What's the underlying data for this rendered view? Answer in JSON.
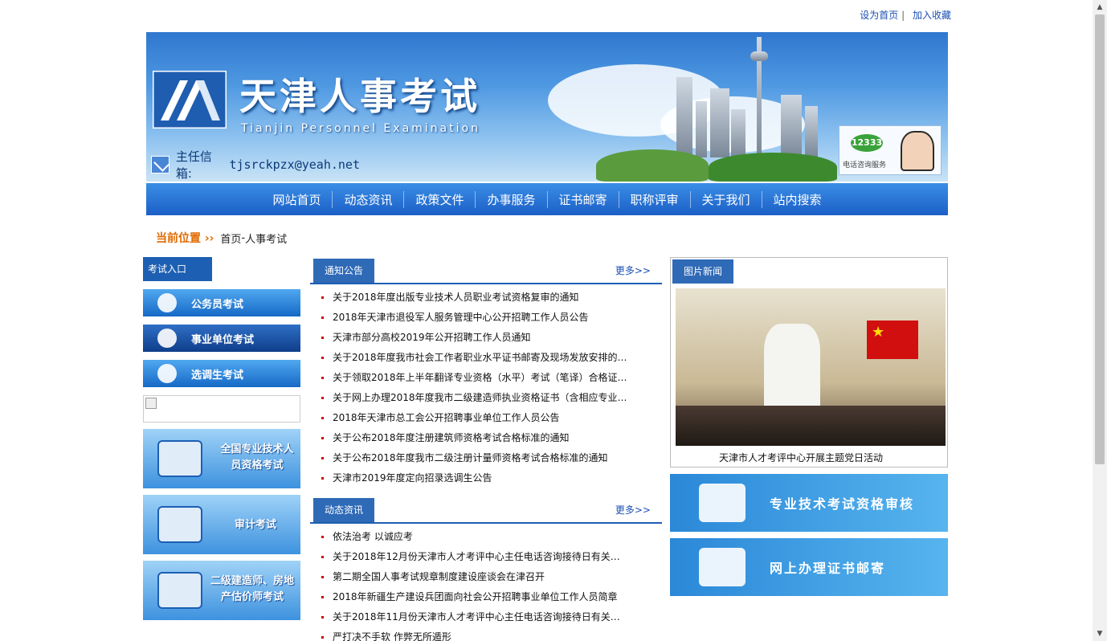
{
  "toplinks": {
    "home": "设为首页",
    "sep": "|",
    "fav": "加入收藏"
  },
  "banner": {
    "title": "天津人事考试",
    "subtitle": "Tianjin Personnel Examination",
    "mail_label": "主任信箱:",
    "mail_addr": "tjsrckpzx@yeah.net",
    "hotline_badge": "12333",
    "hotline_label": "电话咨询服务"
  },
  "nav": [
    "网站首页",
    "动态资讯",
    "政策文件",
    "办事服务",
    "证书邮寄",
    "职称评审",
    "关于我们",
    "站内搜索"
  ],
  "breadcrumb": {
    "where": "当前位置 ››",
    "home": "首页",
    "sep": " - ",
    "current": "人事考试"
  },
  "left": {
    "entry_head": "考试入口",
    "buttons": [
      "公务员考试",
      "事业单位考试",
      "选调生考试"
    ],
    "tiles": [
      "全国专业技术人员资格考试",
      "审计考试",
      "二级建造师、房地产估价师考试"
    ]
  },
  "notice": {
    "tab": "通知公告",
    "more": "更多>>",
    "items": [
      "关于2018年度出版专业技术人员职业考试资格复审的通知",
      "2018年天津市退役军人服务管理中心公开招聘工作人员公告",
      "天津市部分高校2019年公开招聘工作人员通知",
      "关于2018年度我市社会工作者职业水平证书邮寄及现场发放安排的…",
      "关于领取2018年上半年翻译专业资格（水平）考试（笔译）合格证…",
      "关于网上办理2018年度我市二级建造师执业资格证书（含相应专业…",
      "2018年天津市总工会公开招聘事业单位工作人员公告",
      "关于公布2018年度注册建筑师资格考试合格标准的通知",
      "关于公布2018年度我市二级注册计量师资格考试合格标准的通知",
      "天津市2019年度定向招录选调生公告"
    ]
  },
  "news": {
    "tab": "动态资讯",
    "more": "更多>>",
    "items": [
      "依法治考 以诚应考",
      "关于2018年12月份天津市人才考评中心主任电话咨询接待日有关…",
      "第二期全国人事考试规章制度建设座谈会在津召开",
      "2018年新疆生产建设兵团面向社会公开招聘事业单位工作人员简章",
      "关于2018年11月份天津市人才考评中心主任电话咨询接待日有关…",
      "严打决不手软 作弊无所遁形"
    ]
  },
  "picnews": {
    "tab": "图片新闻",
    "caption": "天津市人才考评中心开展主题党日活动"
  },
  "promos": [
    "专业技术考试资格审核",
    "网上办理证书邮寄"
  ]
}
